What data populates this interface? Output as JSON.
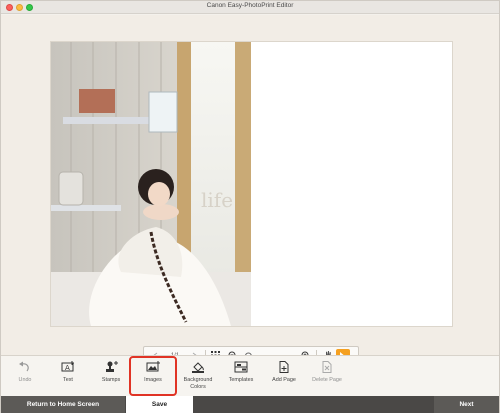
{
  "window": {
    "title": "Canon Easy-PhotoPrint Editor"
  },
  "zoombar": {
    "prev_icon": "chevron-left-icon",
    "page_indicator": "1/1",
    "next_icon": "chevron-right-icon",
    "grid_icon": "grid-icon",
    "zoom_out_icon": "zoom-out-icon",
    "zoom_in_icon": "zoom-in-icon",
    "zoom_level": 0.1,
    "hand_icon": "hand-icon",
    "pointer_icon": "pointer-icon",
    "accent": "#f5a020"
  },
  "toolbar": {
    "items": [
      {
        "label": "Undo",
        "icon": "undo-icon",
        "enabled": false
      },
      {
        "label": "Text",
        "icon": "text-icon",
        "enabled": true
      },
      {
        "label": "Stamps",
        "icon": "stamp-icon",
        "enabled": true
      },
      {
        "label": "Images",
        "icon": "image-icon",
        "enabled": true,
        "selected": true
      },
      {
        "label": "Background\nColors",
        "icon": "background-color-icon",
        "enabled": true
      },
      {
        "label": "Templates",
        "icon": "templates-icon",
        "enabled": true
      },
      {
        "label": "Add Page",
        "icon": "add-page-icon",
        "enabled": true
      },
      {
        "label": "Delete Page",
        "icon": "delete-page-icon",
        "enabled": false
      }
    ],
    "selected_outline": "#e03325"
  },
  "footer": {
    "home_label": "Return to Home Screen",
    "save_label": "Save",
    "next_label": "Next"
  },
  "photo": {
    "watermark_text": "life"
  }
}
